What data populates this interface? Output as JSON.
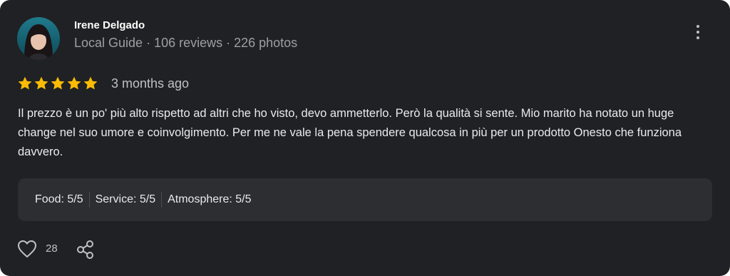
{
  "reviewer": {
    "name": "Irene Delgado",
    "meta": "Local Guide · 106 reviews · 226 photos"
  },
  "rating": {
    "stars": 5,
    "star_color": "#fbbc04",
    "age": "3 months ago"
  },
  "review_text": "Il prezzo è un po' più alto rispetto ad altri che ho visto, devo ammetterlo. Però la qualità si sente. Mio marito ha notato un huge change nel suo umore e coinvolgimento. Per me ne vale la pena spendere qualcosa in più per un prodotto Onesto che funziona davvero.",
  "sub_ratings": {
    "food": "Food: 5/5",
    "service": "Service: 5/5",
    "atmosphere": "Atmosphere: 5/5"
  },
  "actions": {
    "like_count": "28",
    "like_icon": "heart-icon",
    "share_icon": "share-icon",
    "more_icon": "more-vertical-icon"
  },
  "colors": {
    "card_bg": "#202124",
    "panel_bg": "#2d2e31",
    "accent_star": "#fbbc04"
  }
}
